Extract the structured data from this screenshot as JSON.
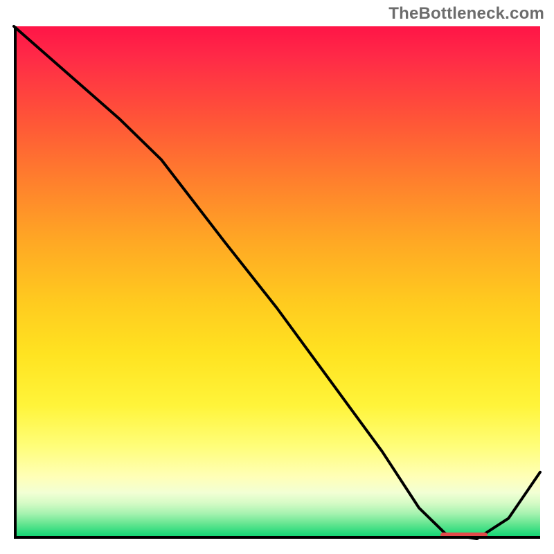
{
  "watermark": "TheBottleneck.com",
  "colors": {
    "curve": "#000000",
    "marker": "#E24A4A"
  },
  "chart_data": {
    "type": "line",
    "title": "",
    "xlabel": "",
    "ylabel": "",
    "xlim": [
      0,
      100
    ],
    "ylim": [
      0,
      100
    ],
    "x": [
      0,
      10,
      20,
      28,
      40,
      50,
      60,
      70,
      77,
      82,
      88,
      94,
      100
    ],
    "values": [
      100,
      91,
      82,
      74,
      58,
      45,
      31,
      17,
      6,
      1,
      0,
      4,
      13
    ],
    "optimum_band": {
      "x_start": 81,
      "x_end": 90,
      "y": 0
    }
  }
}
